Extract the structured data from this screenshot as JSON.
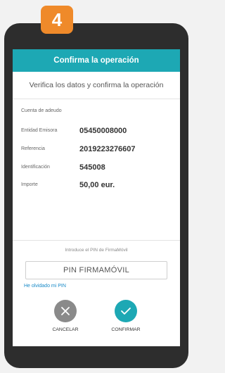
{
  "step": {
    "number": "4",
    "color": "#ef8a2a"
  },
  "header": {
    "title": "Confirma la operación",
    "color": "#1da8b4"
  },
  "subheader": {
    "text": "Verifica los datos y confirma la operación"
  },
  "details": {
    "section_title": "Cuenta de adeudo",
    "rows": [
      {
        "label": "Entidad Emisora",
        "value": "05450008000"
      },
      {
        "label": "Referencia",
        "value": "2019223276607"
      },
      {
        "label": "Identificación",
        "value": "545008"
      },
      {
        "label": "Importe",
        "value": "50,00 eur."
      }
    ]
  },
  "pin": {
    "caption": "Introduce el PIN de FirmaMóvil",
    "placeholder": "PIN FIRMAMÓVIL",
    "forgot_link": "He olvidado mi PIN"
  },
  "actions": {
    "cancel": {
      "label": "CANCELAR",
      "icon": "close-icon",
      "color": "#8a8a8a"
    },
    "confirm": {
      "label": "CONFIRMAR",
      "icon": "check-icon",
      "color": "#1da8b4"
    }
  }
}
